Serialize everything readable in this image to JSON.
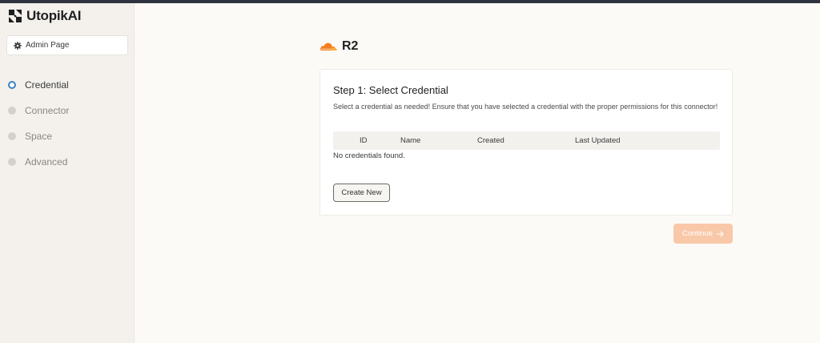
{
  "brand": {
    "name": "UtopikAI",
    "logo_icon": "utopik-logo-icon"
  },
  "sidebar": {
    "admin_label": "Admin Page",
    "admin_icon": "gear-icon",
    "steps": [
      {
        "label": "Credential",
        "active": true
      },
      {
        "label": "Connector",
        "active": false
      },
      {
        "label": "Space",
        "active": false
      },
      {
        "label": "Advanced",
        "active": false
      }
    ]
  },
  "main": {
    "title": "R2",
    "title_icon": "cloudflare-cloud-icon",
    "card": {
      "title": "Step 1: Select Credential",
      "description": "Select a credential as needed! Ensure that you have selected a credential with the proper permissions for this connector!",
      "columns": [
        "ID",
        "Name",
        "Created",
        "Last Updated"
      ],
      "empty_message": "No credentials found.",
      "create_label": "Create New"
    },
    "continue_label": "Continue",
    "continue_icon": "arrow-right-icon"
  },
  "colors": {
    "accent_blue": "#3b82c4",
    "continue_disabled": "#f9c8a9",
    "cloudflare_orange": "#f38020"
  }
}
